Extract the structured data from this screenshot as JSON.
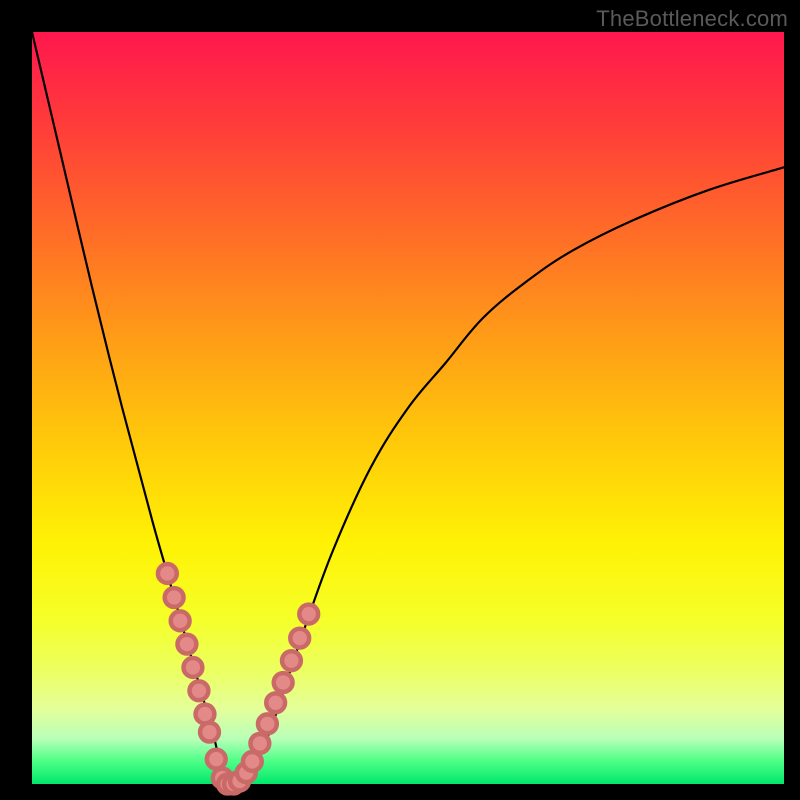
{
  "watermark": "TheBottleneck.com",
  "colors": {
    "frame_bg": "#000000",
    "curve_stroke": "#000000",
    "dot_fill": "#e38a88",
    "dot_stroke": "#c96a68"
  },
  "chart_data": {
    "type": "line",
    "title": "",
    "xlabel": "",
    "ylabel": "",
    "xlim": [
      0,
      100
    ],
    "ylim": [
      0,
      100
    ],
    "grid": false,
    "legend": false,
    "gradient_stops": [
      {
        "pos": 0,
        "color": "#ff174e"
      },
      {
        "pos": 12,
        "color": "#ff3b3a"
      },
      {
        "pos": 26,
        "color": "#ff6a28"
      },
      {
        "pos": 40,
        "color": "#ff9a18"
      },
      {
        "pos": 54,
        "color": "#ffc80a"
      },
      {
        "pos": 68,
        "color": "#fff205"
      },
      {
        "pos": 78,
        "color": "#f5ff28"
      },
      {
        "pos": 85,
        "color": "#ecff62"
      },
      {
        "pos": 90,
        "color": "#e4ff9a"
      },
      {
        "pos": 94,
        "color": "#b8ffb8"
      },
      {
        "pos": 97,
        "color": "#4cff86"
      },
      {
        "pos": 100,
        "color": "#00e86b"
      }
    ],
    "series": [
      {
        "name": "bottleneck-curve",
        "x": [
          0,
          4,
          8,
          12,
          16,
          18,
          20,
          22,
          24,
          25,
          26,
          27,
          28,
          29,
          30,
          32,
          34,
          36,
          40,
          45,
          50,
          55,
          60,
          66,
          72,
          80,
          90,
          100
        ],
        "y": [
          100,
          83,
          66,
          50,
          35,
          28,
          21,
          14,
          7,
          3,
          1,
          0,
          0,
          1,
          3,
          8,
          14,
          20,
          31,
          42,
          50,
          56,
          62,
          67,
          71,
          75,
          79,
          82
        ]
      }
    ],
    "marker_points": {
      "name": "highlight-dots",
      "x": [
        18.0,
        18.9,
        19.7,
        20.6,
        21.4,
        22.2,
        23.0,
        23.6,
        24.5,
        25.3,
        26.0,
        26.8,
        27.6,
        28.5,
        29.3,
        30.3,
        31.3,
        32.4,
        33.4,
        34.5,
        35.6,
        36.8
      ],
      "y": [
        28.0,
        24.8,
        21.7,
        18.6,
        15.5,
        12.4,
        9.3,
        6.9,
        3.3,
        0.8,
        0.0,
        0.0,
        0.4,
        1.5,
        3.0,
        5.4,
        8.0,
        10.8,
        13.5,
        16.4,
        19.4,
        22.6
      ]
    }
  }
}
